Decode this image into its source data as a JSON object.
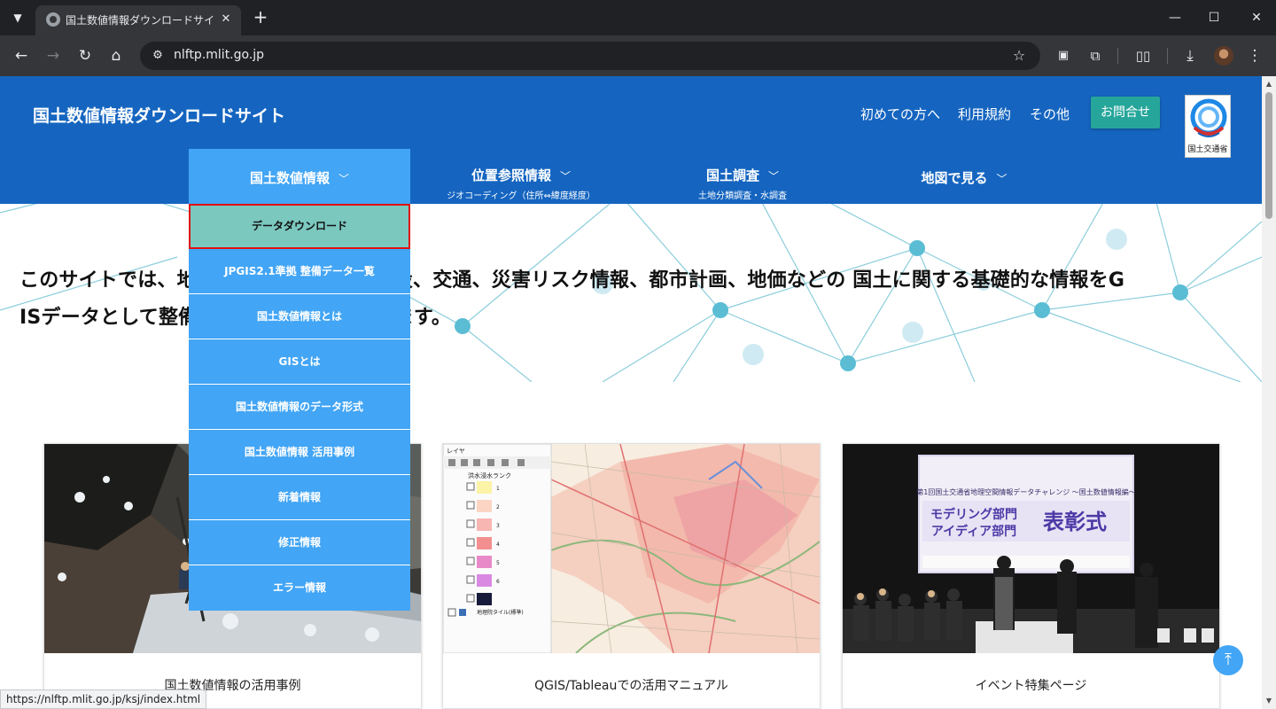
{
  "browser": {
    "tab_title": "国土数値情報ダウンロードサイト",
    "url": "nlftp.mlit.go.jp",
    "status_url": "https://nlftp.mlit.go.jp/ksj/index.html"
  },
  "header": {
    "site_title": "国土数値情報ダウンロードサイト",
    "links": [
      "初めての方へ",
      "利用規約",
      "その他"
    ],
    "contact_label": "お問合せ",
    "logo_text": "国土交通省"
  },
  "nav": [
    {
      "label": "国土数値情報",
      "sub": ""
    },
    {
      "label": "位置参照情報",
      "sub": "ジオコーディング（住所⇔緯度経度）"
    },
    {
      "label": "国土調査",
      "sub": "土地分類調査・水調査"
    },
    {
      "label": "地図で見る",
      "sub": ""
    }
  ],
  "dropdown": [
    "データダウンロード",
    "JPGIS2.1準拠 整備データ一覧",
    "国土数値情報とは",
    "GISとは",
    "国土数値情報のデータ形式",
    "国土数値情報 活用事例",
    "新着情報",
    "修正情報",
    "エラー情報"
  ],
  "hero": {
    "text_line1": "このサイトでは、地形、土地利用、公共施設、交通、災害リスク情報、都市計画、地価などの 国土に関する基礎的な情報をG",
    "text_line2": "ISデータとして整備し、無償で提供しています。"
  },
  "cards": [
    {
      "caption": "国土数値情報の活用事例"
    },
    {
      "caption": "QGIS/Tableauでの活用マニュアル"
    },
    {
      "caption": "イベント特集ページ"
    }
  ],
  "qgis_panel": {
    "title": "レイヤ",
    "layer_group": "洪水浸水ランク",
    "ranks": [
      "1",
      "2",
      "3",
      "4",
      "5",
      "6",
      ""
    ],
    "base_layer": "地理院タイル(標準)"
  },
  "event_banner": {
    "top": "第1回国土交通省地理空間情報データチャレンジ 〜国土数値情報編〜",
    "line1": "モデリング部門",
    "line2": "アイディア部門",
    "big": "表彰式"
  },
  "colors": {
    "header_blue": "#1565c0",
    "nav_active": "#42a5f5",
    "contact_green": "#26a69a",
    "selected_item": "#7bc8bf",
    "selected_border": "#e01010"
  }
}
